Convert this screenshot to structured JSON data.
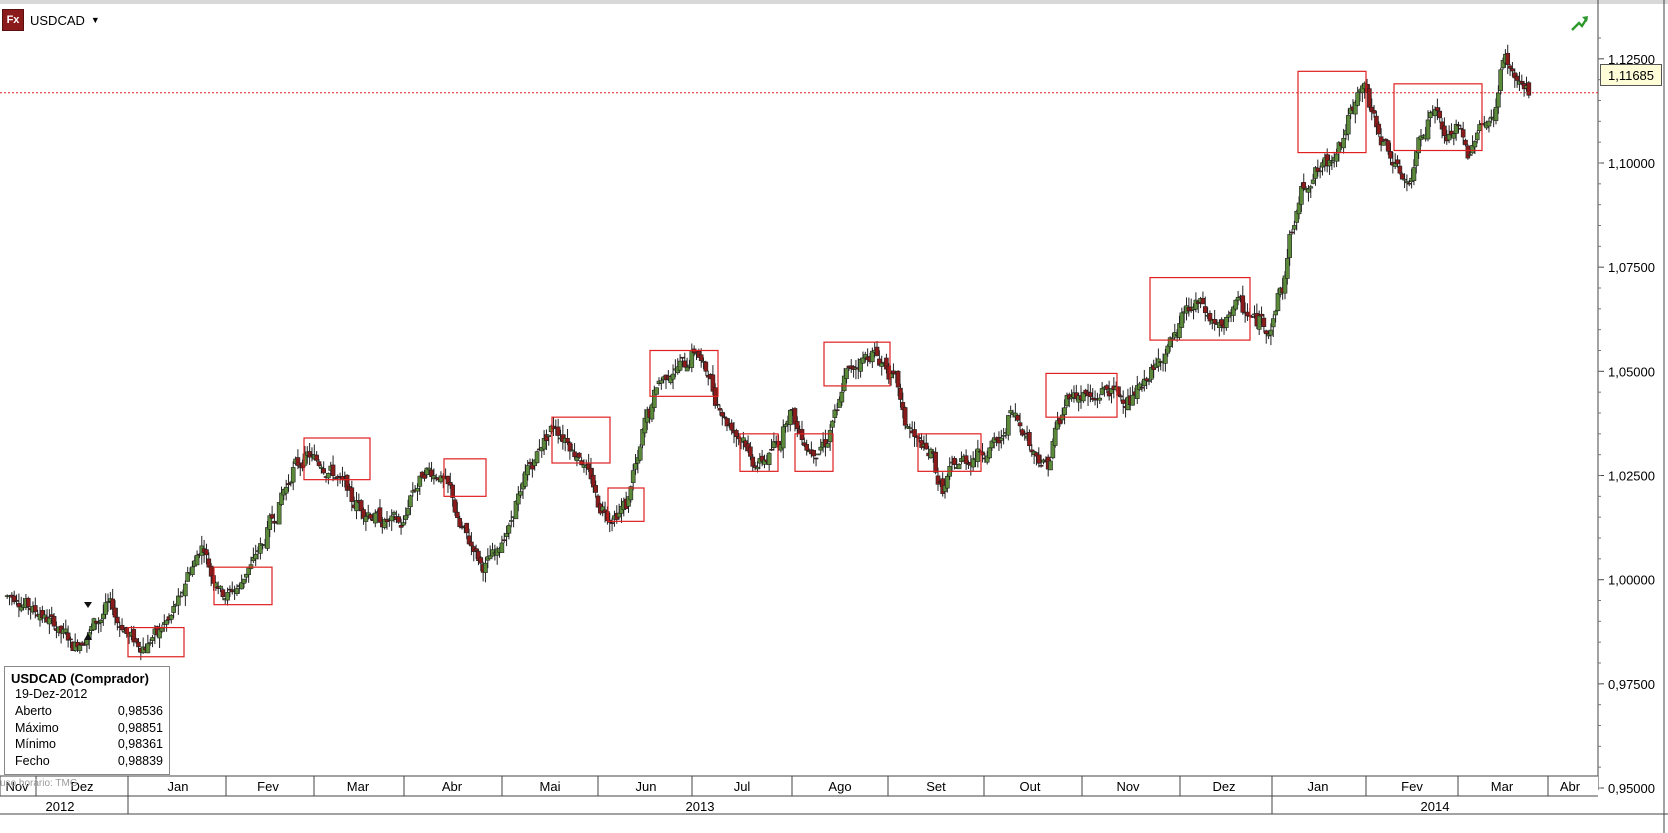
{
  "header": {
    "app_icon_label": "Fx",
    "symbol": "USDCAD",
    "dropdown_icon": "triangle-down-icon",
    "trend_icon": "green-trend-arrow-icon"
  },
  "colors": {
    "up_candle": "#5a8a3a",
    "down_candle": "#8b1a1a",
    "box_stroke": "#e02020",
    "current_price_line": "#e02020",
    "grid": "#e6e6e6"
  },
  "current_price": {
    "value": 1.11685,
    "label": "1,11685"
  },
  "infobox": {
    "title": "USDCAD (Comprador)",
    "date": "19-Dez-2012",
    "rows": [
      {
        "label": "Aberto",
        "value": "0,98536"
      },
      {
        "label": "Máximo",
        "value": "0,98851"
      },
      {
        "label": "Mínimo",
        "value": "0,98361"
      },
      {
        "label": "Fecho",
        "value": "0,98839"
      }
    ]
  },
  "timezone_label": "uso horário: TMG",
  "chart_data": {
    "type": "candlestick",
    "symbol": "USDCAD",
    "ylim": [
      0.95,
      1.13
    ],
    "y_ticks": [
      0.95,
      0.975,
      1.0,
      1.025,
      1.05,
      1.075,
      1.1,
      1.125
    ],
    "y_tick_labels": [
      "0,95000",
      "0,97500",
      "1,00000",
      "1,02500",
      "1,05000",
      "1,07500",
      "1,10000",
      "1,12500"
    ],
    "month_labels": [
      "Nov",
      "Dez",
      "Jan",
      "Fev",
      "Mar",
      "Abr",
      "Mai",
      "Jun",
      "Jul",
      "Ago",
      "Set",
      "Out",
      "Nov",
      "Dez",
      "Jan",
      "Fev",
      "Mar",
      "Abr"
    ],
    "year_labels": [
      "2012",
      "2013",
      "2014"
    ],
    "grid": false,
    "weekly_closes": [
      0.996,
      0.994,
      0.992,
      0.99,
      0.987,
      0.984,
      0.986,
      0.99,
      0.994,
      0.989,
      0.986,
      0.984,
      0.987,
      0.99,
      0.995,
      1.003,
      1.008,
      1.0,
      0.996,
      0.998,
      1.003,
      1.008,
      1.015,
      1.022,
      1.028,
      1.03,
      1.028,
      1.026,
      1.023,
      1.018,
      1.016,
      1.015,
      1.014,
      1.013,
      1.022,
      1.026,
      1.025,
      1.022,
      1.012,
      1.008,
      1.003,
      1.006,
      1.012,
      1.02,
      1.028,
      1.033,
      1.037,
      1.034,
      1.03,
      1.025,
      1.017,
      1.015,
      1.018,
      1.028,
      1.04,
      1.048,
      1.05,
      1.052,
      1.055,
      1.05,
      1.042,
      1.037,
      1.034,
      1.028,
      1.029,
      1.033,
      1.04,
      1.035,
      1.031,
      1.033,
      1.04,
      1.05,
      1.052,
      1.054,
      1.052,
      1.048,
      1.037,
      1.033,
      1.03,
      1.022,
      1.027,
      1.029,
      1.03,
      1.031,
      1.033,
      1.04,
      1.036,
      1.03,
      1.028,
      1.038,
      1.045,
      1.044,
      1.043,
      1.046,
      1.045,
      1.043,
      1.046,
      1.05,
      1.054,
      1.058,
      1.065,
      1.066,
      1.062,
      1.06,
      1.066,
      1.064,
      1.062,
      1.06,
      1.07,
      1.085,
      1.095,
      1.098,
      1.1,
      1.105,
      1.112,
      1.118,
      1.11,
      1.104,
      1.098,
      1.095,
      1.108,
      1.113,
      1.106,
      1.108,
      1.102,
      1.11,
      1.11,
      1.125,
      1.12,
      1.117
    ],
    "highlight_boxes_price": [
      [
        0.9815,
        0.9885
      ],
      [
        0.994,
        1.003
      ],
      [
        1.024,
        1.034
      ],
      [
        1.02,
        1.029
      ],
      [
        1.028,
        1.039
      ],
      [
        1.014,
        1.022
      ],
      [
        1.044,
        1.055
      ],
      [
        1.026,
        1.035
      ],
      [
        1.026,
        1.035
      ],
      [
        1.0465,
        1.057
      ],
      [
        1.026,
        1.035
      ],
      [
        1.039,
        1.0495
      ],
      [
        1.0575,
        1.0725
      ],
      [
        1.1025,
        1.122
      ],
      [
        1.103,
        1.119
      ]
    ]
  }
}
